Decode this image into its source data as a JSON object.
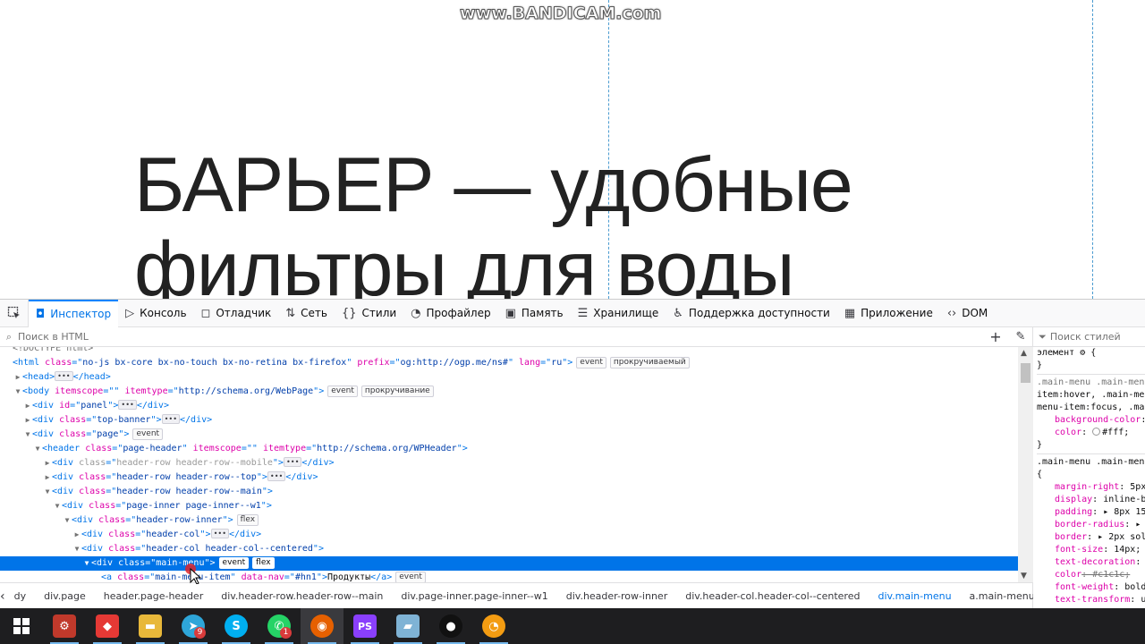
{
  "watermark": "www.BANDICAM.com",
  "page": {
    "hero_line1": "БАРЬЕР — удобные",
    "hero_line2": "фильтры для воды"
  },
  "devtools": {
    "tabs": [
      {
        "label": "Инспектор",
        "icon": "inspector-icon",
        "glyph": "◘"
      },
      {
        "label": "Консоль",
        "icon": "console-icon",
        "glyph": "▷"
      },
      {
        "label": "Отладчик",
        "icon": "debugger-icon",
        "glyph": "◻"
      },
      {
        "label": "Сеть",
        "icon": "network-icon",
        "glyph": "⇅"
      },
      {
        "label": "Стили",
        "icon": "styles-icon",
        "glyph": "{}"
      },
      {
        "label": "Профайлер",
        "icon": "profiler-icon",
        "glyph": "◔"
      },
      {
        "label": "Память",
        "icon": "memory-icon",
        "glyph": "▣"
      },
      {
        "label": "Хранилище",
        "icon": "storage-icon",
        "glyph": "☰"
      },
      {
        "label": "Поддержка доступности",
        "icon": "accessibility-icon",
        "glyph": "♿"
      },
      {
        "label": "Приложение",
        "icon": "application-icon",
        "glyph": "▦"
      },
      {
        "label": "DOM",
        "icon": "dom-icon",
        "glyph": "‹›"
      }
    ],
    "html_search_placeholder": "Поиск в HTML",
    "styles_search_placeholder": "Поиск стилей",
    "tree": [
      {
        "indent": 0,
        "twisty": "",
        "html": "<span class=\"cm\">&lt;!DOCTYPE html&gt;</span>"
      },
      {
        "indent": 0,
        "twisty": "",
        "tag": "html",
        "attrs": [
          [
            "class",
            "no-js bx-core bx-no-touch bx-no-retina bx-firefox"
          ],
          [
            "prefix",
            "og:http://ogp.me/ns#"
          ],
          [
            "lang",
            "ru"
          ]
        ],
        "badges": [
          "event",
          "прокручиваемый"
        ]
      },
      {
        "indent": 1,
        "twisty": "▶",
        "tag": "head",
        "collapsed": true,
        "close": "head"
      },
      {
        "indent": 1,
        "twisty": "▼",
        "tag": "body",
        "attrs": [
          [
            "itemscope",
            ""
          ],
          [
            "itemtype",
            "http://schema.org/WebPage"
          ]
        ],
        "badges": [
          "event",
          "прокручивание"
        ]
      },
      {
        "indent": 2,
        "twisty": "▶",
        "tag": "div",
        "attrs": [
          [
            "id",
            "panel"
          ]
        ],
        "collapsed": true,
        "close": "div"
      },
      {
        "indent": 2,
        "twisty": "▶",
        "tag": "div",
        "attrs": [
          [
            "class",
            "top-banner"
          ]
        ],
        "collapsed": true,
        "close": "div"
      },
      {
        "indent": 2,
        "twisty": "▼",
        "tag": "div",
        "attrs": [
          [
            "class",
            "page"
          ]
        ],
        "badges": [
          "event"
        ]
      },
      {
        "indent": 3,
        "twisty": "▼",
        "tag": "header",
        "attrs": [
          [
            "class",
            "page-header"
          ],
          [
            "itemscope",
            ""
          ],
          [
            "itemtype",
            "http://schema.org/WPHeader"
          ]
        ]
      },
      {
        "indent": 4,
        "twisty": "▶",
        "tag": "div",
        "attrs": [
          [
            "class",
            "header-row header-row--mobile"
          ]
        ],
        "collapsed": true,
        "close": "div",
        "dim": true
      },
      {
        "indent": 4,
        "twisty": "▶",
        "tag": "div",
        "attrs": [
          [
            "class",
            "header-row header-row--top"
          ]
        ],
        "collapsed": true,
        "close": "div"
      },
      {
        "indent": 4,
        "twisty": "▼",
        "tag": "div",
        "attrs": [
          [
            "class",
            "header-row header-row--main"
          ]
        ]
      },
      {
        "indent": 5,
        "twisty": "▼",
        "tag": "div",
        "attrs": [
          [
            "class",
            "page-inner page-inner--w1"
          ]
        ]
      },
      {
        "indent": 6,
        "twisty": "▼",
        "tag": "div",
        "attrs": [
          [
            "class",
            "header-row-inner"
          ]
        ],
        "badges": [
          "flex"
        ]
      },
      {
        "indent": 7,
        "twisty": "▶",
        "tag": "div",
        "attrs": [
          [
            "class",
            "header-col"
          ]
        ],
        "collapsed": true,
        "close": "div"
      },
      {
        "indent": 7,
        "twisty": "▼",
        "tag": "div",
        "attrs": [
          [
            "class",
            "header-col header-col--centered"
          ]
        ]
      },
      {
        "indent": 8,
        "twisty": "▼",
        "tag": "div",
        "attrs": [
          [
            "class",
            "main-menu"
          ]
        ],
        "badges": [
          "event",
          "flex"
        ],
        "selected": true
      },
      {
        "indent": 9,
        "twisty": "",
        "tag": "a",
        "attrs": [
          [
            "class",
            "main-menu-item"
          ],
          [
            "data-nav",
            "#hn1"
          ]
        ],
        "text": "Продукты",
        "close": "a",
        "badges": [
          "event"
        ]
      }
    ],
    "breadcrumbs": [
      "dy",
      "div.page",
      "header.page-header",
      "div.header-row.header-row--main",
      "div.page-inner.page-inner--w1",
      "div.header-row-inner",
      "div.header-col.header-col--centered",
      "div.main-menu",
      "a.main-menu-item"
    ],
    "styles": {
      "element_label": "элемент",
      "rule1_selector_a": ".main-menu .main-menu-",
      "rule1_selector_b": "item:hover, .main-menu-",
      "rule1_selector_c": "menu-item:focus, .ma",
      "rule1_props": [
        [
          "background-color",
          ":"
        ],
        [
          "color",
          ": #fff;"
        ]
      ],
      "rule2_selector": ".main-menu .main-menu-",
      "rule2_props": [
        [
          "margin-right",
          ": 5px"
        ],
        [
          "display",
          ": inline-b"
        ],
        [
          "padding",
          ": ▸ 8px 15p"
        ],
        [
          "border-radius",
          ": ▸ 4"
        ],
        [
          "border",
          ": ▸ 2px soli"
        ],
        [
          "font-size",
          ": 14px;"
        ],
        [
          "text-decoration",
          ":"
        ],
        [
          "color",
          ": #c1c1c;"
        ],
        [
          "font-weight",
          ": bold"
        ],
        [
          "text-transform",
          ": u"
        ]
      ]
    }
  },
  "taskbar": {
    "apps": [
      {
        "name": "start-button",
        "icon": "windows-icon"
      },
      {
        "name": "taskbar-app-1",
        "icon": "app-icon-red",
        "color": "#c0392b",
        "glyph": "⚙"
      },
      {
        "name": "taskbar-app-anydesk",
        "icon": "anydesk-icon",
        "color": "#e53935",
        "glyph": "◆"
      },
      {
        "name": "taskbar-app-explorer",
        "icon": "folder-icon",
        "color": "#e8b83a",
        "glyph": "▬"
      },
      {
        "name": "taskbar-app-telegram",
        "icon": "telegram-icon",
        "color": "#2ea6d9",
        "glyph": "➤",
        "badge": "9"
      },
      {
        "name": "taskbar-app-skype",
        "icon": "skype-icon",
        "color": "#00aff0",
        "glyph": "S"
      },
      {
        "name": "taskbar-app-whatsapp",
        "icon": "whatsapp-icon",
        "color": "#25d366",
        "glyph": "✆",
        "badge": "1"
      },
      {
        "name": "taskbar-app-firefox",
        "icon": "firefox-icon",
        "color": "#e66000",
        "glyph": "◉",
        "active": true
      },
      {
        "name": "taskbar-app-phpstorm",
        "icon": "phpstorm-icon",
        "color": "#8a3ffc",
        "glyph": "PS"
      },
      {
        "name": "taskbar-app-notepad",
        "icon": "notepad-icon",
        "color": "#7fb3d5",
        "glyph": "▰"
      },
      {
        "name": "taskbar-app-bandicam",
        "icon": "record-icon",
        "color": "#111111",
        "glyph": "●"
      },
      {
        "name": "taskbar-app-media",
        "icon": "media-icon",
        "color": "#f39c12",
        "glyph": "◔"
      }
    ]
  }
}
